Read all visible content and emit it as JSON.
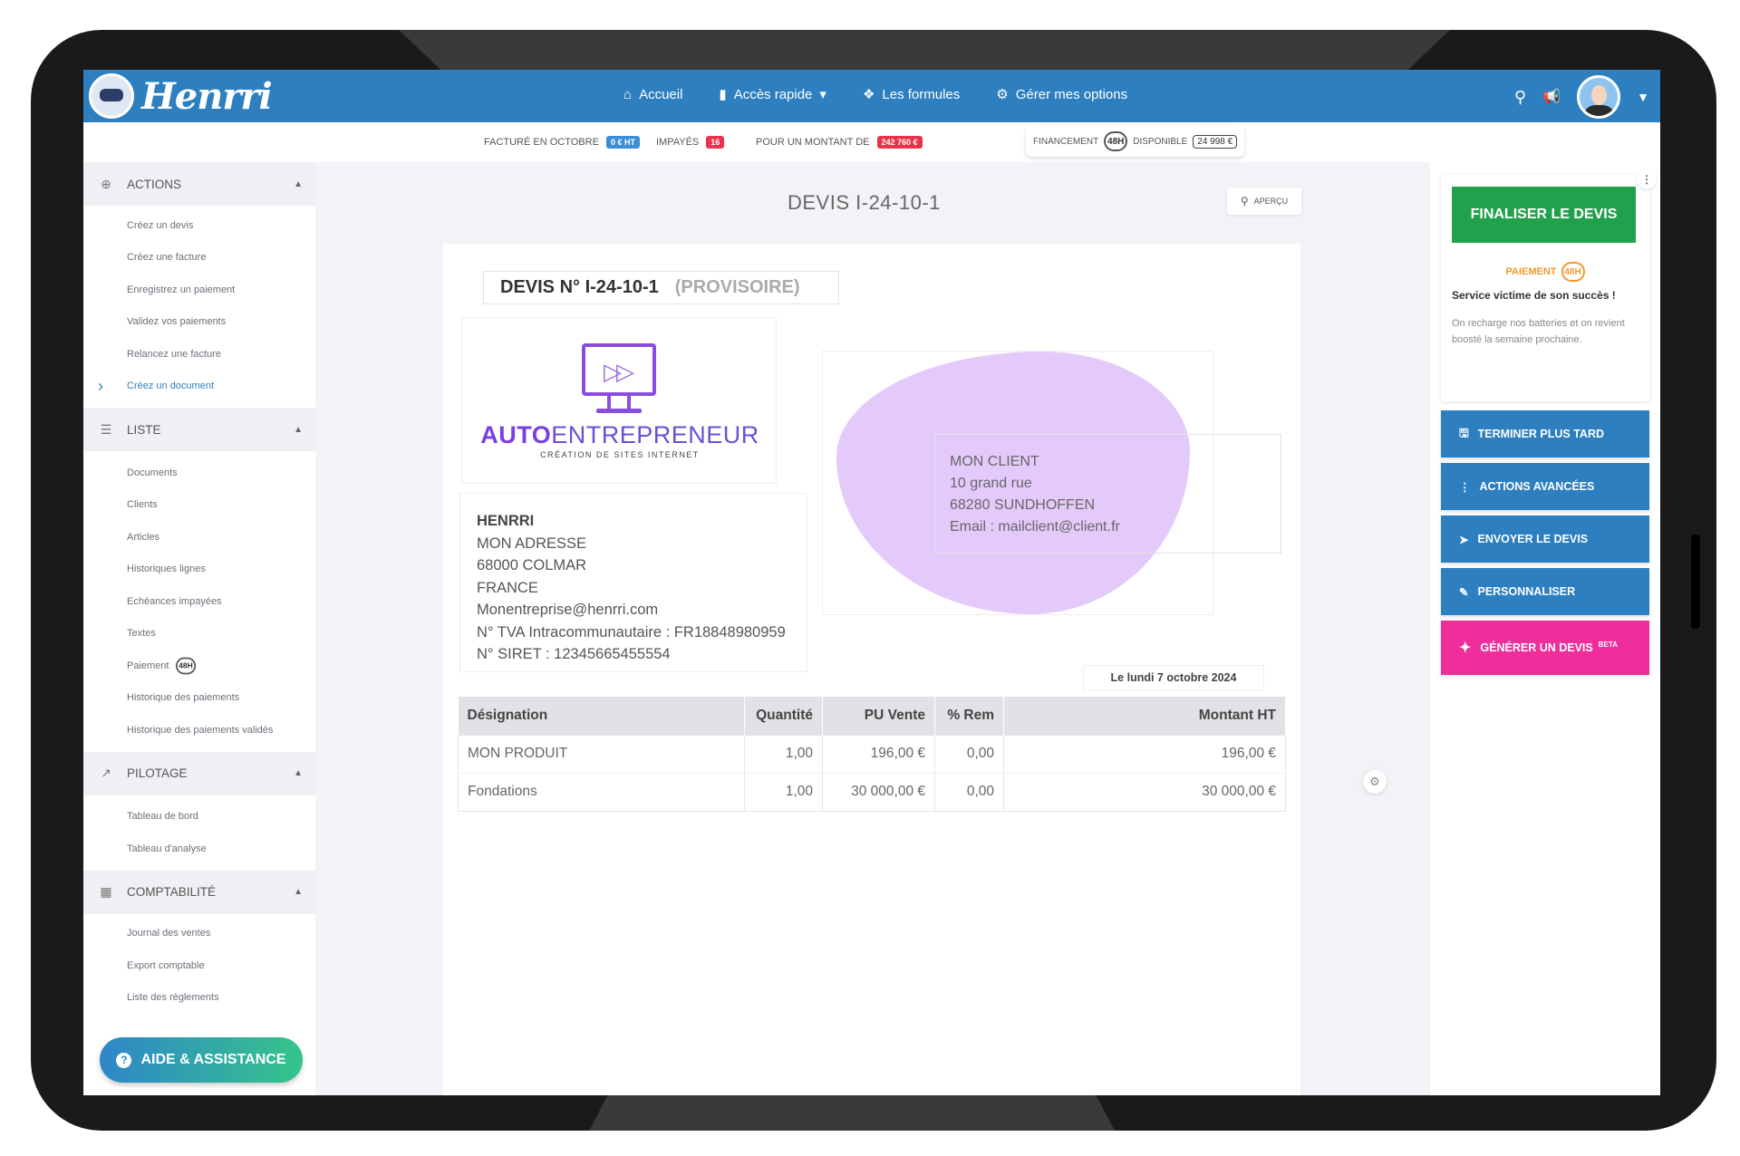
{
  "nav": {
    "brand": "Henrri",
    "items": [
      "Accueil",
      "Accès rapide",
      "Les formules",
      "Gérer mes options"
    ]
  },
  "status": {
    "facture_label": "FACTURÉ EN OCTOBRE",
    "facture_value": "0 € HT",
    "impayes_label": "IMPAYÉS",
    "impayes_value": "16",
    "montant_label": "POUR UN MONTANT DE",
    "montant_value": "242 760 €",
    "financement_label": "FINANCEMENT",
    "financement_clock": "48H",
    "disponible_label": "DISPONIBLE",
    "disponible_value": "24 998 €"
  },
  "sidebar": {
    "actions": {
      "title": "ACTIONS",
      "items": [
        "Créez un devis",
        "Créez une facture",
        "Enregistrez un paiement",
        "Validez vos paiements",
        "Relancez une facture",
        "Créez un document"
      ]
    },
    "liste": {
      "title": "LISTE",
      "items": [
        "Documents",
        "Clients",
        "Articles",
        "Historiques lignes",
        "Echéances impayées",
        "Textes",
        "Paiement",
        "Historique des paiements",
        "Historique des paiements validés"
      ],
      "clock": "48H"
    },
    "pilotage": {
      "title": "PILOTAGE",
      "items": [
        "Tableau de bord",
        "Tableau d'analyse"
      ]
    },
    "compta": {
      "title": "COMPTABILITÉ",
      "items": [
        "Journal des ventes",
        "Export comptable",
        "Liste des règlements"
      ]
    },
    "aide": "AIDE & ASSISTANCE"
  },
  "doc": {
    "title": "DEVIS I-24-10-1",
    "apercu": "APERÇU",
    "head_number": "DEVIS N° I-24-10-1",
    "head_status": "(PROVISOIRE)",
    "logo_word1": "AUTO",
    "logo_word2": "ENTREPRENEUR",
    "logo_sub": "CRÉATION DE SITES INTERNET",
    "sender": [
      "HENRRI",
      "MON ADRESSE",
      "68000 COLMAR",
      "FRANCE",
      "Monentreprise@henrri.com",
      "N° TVA Intracommunautaire : FR18848980959",
      "N° SIRET : 12345665455554"
    ],
    "client": [
      "MON CLIENT",
      "10 grand rue",
      "68280 SUNDHOFFEN",
      "Email : mailclient@client.fr"
    ],
    "date": "Le lundi 7 octobre 2024",
    "table": {
      "headers": [
        "Désignation",
        "Quantité",
        "PU Vente",
        "% Rem",
        "Montant HT"
      ],
      "rows": [
        [
          "MON PRODUIT",
          "1,00",
          "196,00 €",
          "0,00",
          "196,00 €"
        ],
        [
          "Fondations",
          "1,00",
          "30 000,00 €",
          "0,00",
          "30 000,00 €"
        ]
      ]
    }
  },
  "right": {
    "finaliser": "FINALISER LE DEVIS",
    "paiement": "PAIEMENT",
    "clock": "48H",
    "service": "Service victime de son succès !",
    "service_desc": "On recharge nos batteries et on revient boosté la semaine prochaine.",
    "buttons": [
      "TERMINER PLUS TARD",
      "ACTIONS AVANCÉES",
      "ENVOYER LE DEVIS",
      "PERSONNALISER"
    ],
    "generer": "GÉNÉRER UN DEVIS",
    "beta": "BETA"
  },
  "colors": {
    "brand_blue": "#2d7fbf",
    "success_green": "#22a14d",
    "accent_pink": "#ee2f9b",
    "alert_red": "#e8334a",
    "orange": "#f39a2c",
    "client_blob": "#e4cafa"
  }
}
